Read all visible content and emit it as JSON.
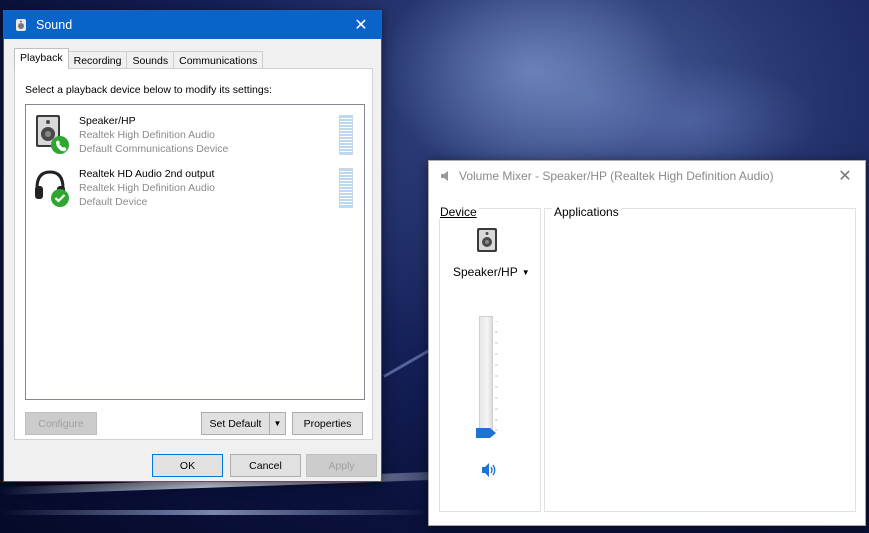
{
  "sound_dialog": {
    "title": "Sound",
    "close": "✕",
    "tabs": [
      "Playback",
      "Recording",
      "Sounds",
      "Communications"
    ],
    "instruction": "Select a playback device below to modify its settings:",
    "devices": [
      {
        "name": "Speaker/HP",
        "driver": "Realtek High Definition Audio",
        "status": "Default Communications Device",
        "icon": "speaker-icon",
        "badge": "phone-badge-icon"
      },
      {
        "name": "Realtek HD Audio 2nd output",
        "driver": "Realtek High Definition Audio",
        "status": "Default Device",
        "icon": "headphones-icon",
        "badge": "checkmark-badge-icon"
      }
    ],
    "buttons": {
      "configure": "Configure",
      "set_default": "Set Default",
      "properties": "Properties",
      "ok": "OK",
      "cancel": "Cancel",
      "apply": "Apply"
    }
  },
  "volume_mixer": {
    "title": "Volume Mixer - Speaker/HP (Realtek High Definition Audio)",
    "close": "✕",
    "device_heading": "Device",
    "applications_heading": "Applications",
    "selected_device": "Speaker/HP",
    "volume_level": 0.0
  },
  "colors": {
    "title_bar": "#0a63c9",
    "badge_green": "#2fa62f",
    "slider_thumb": "#1e73d2"
  }
}
